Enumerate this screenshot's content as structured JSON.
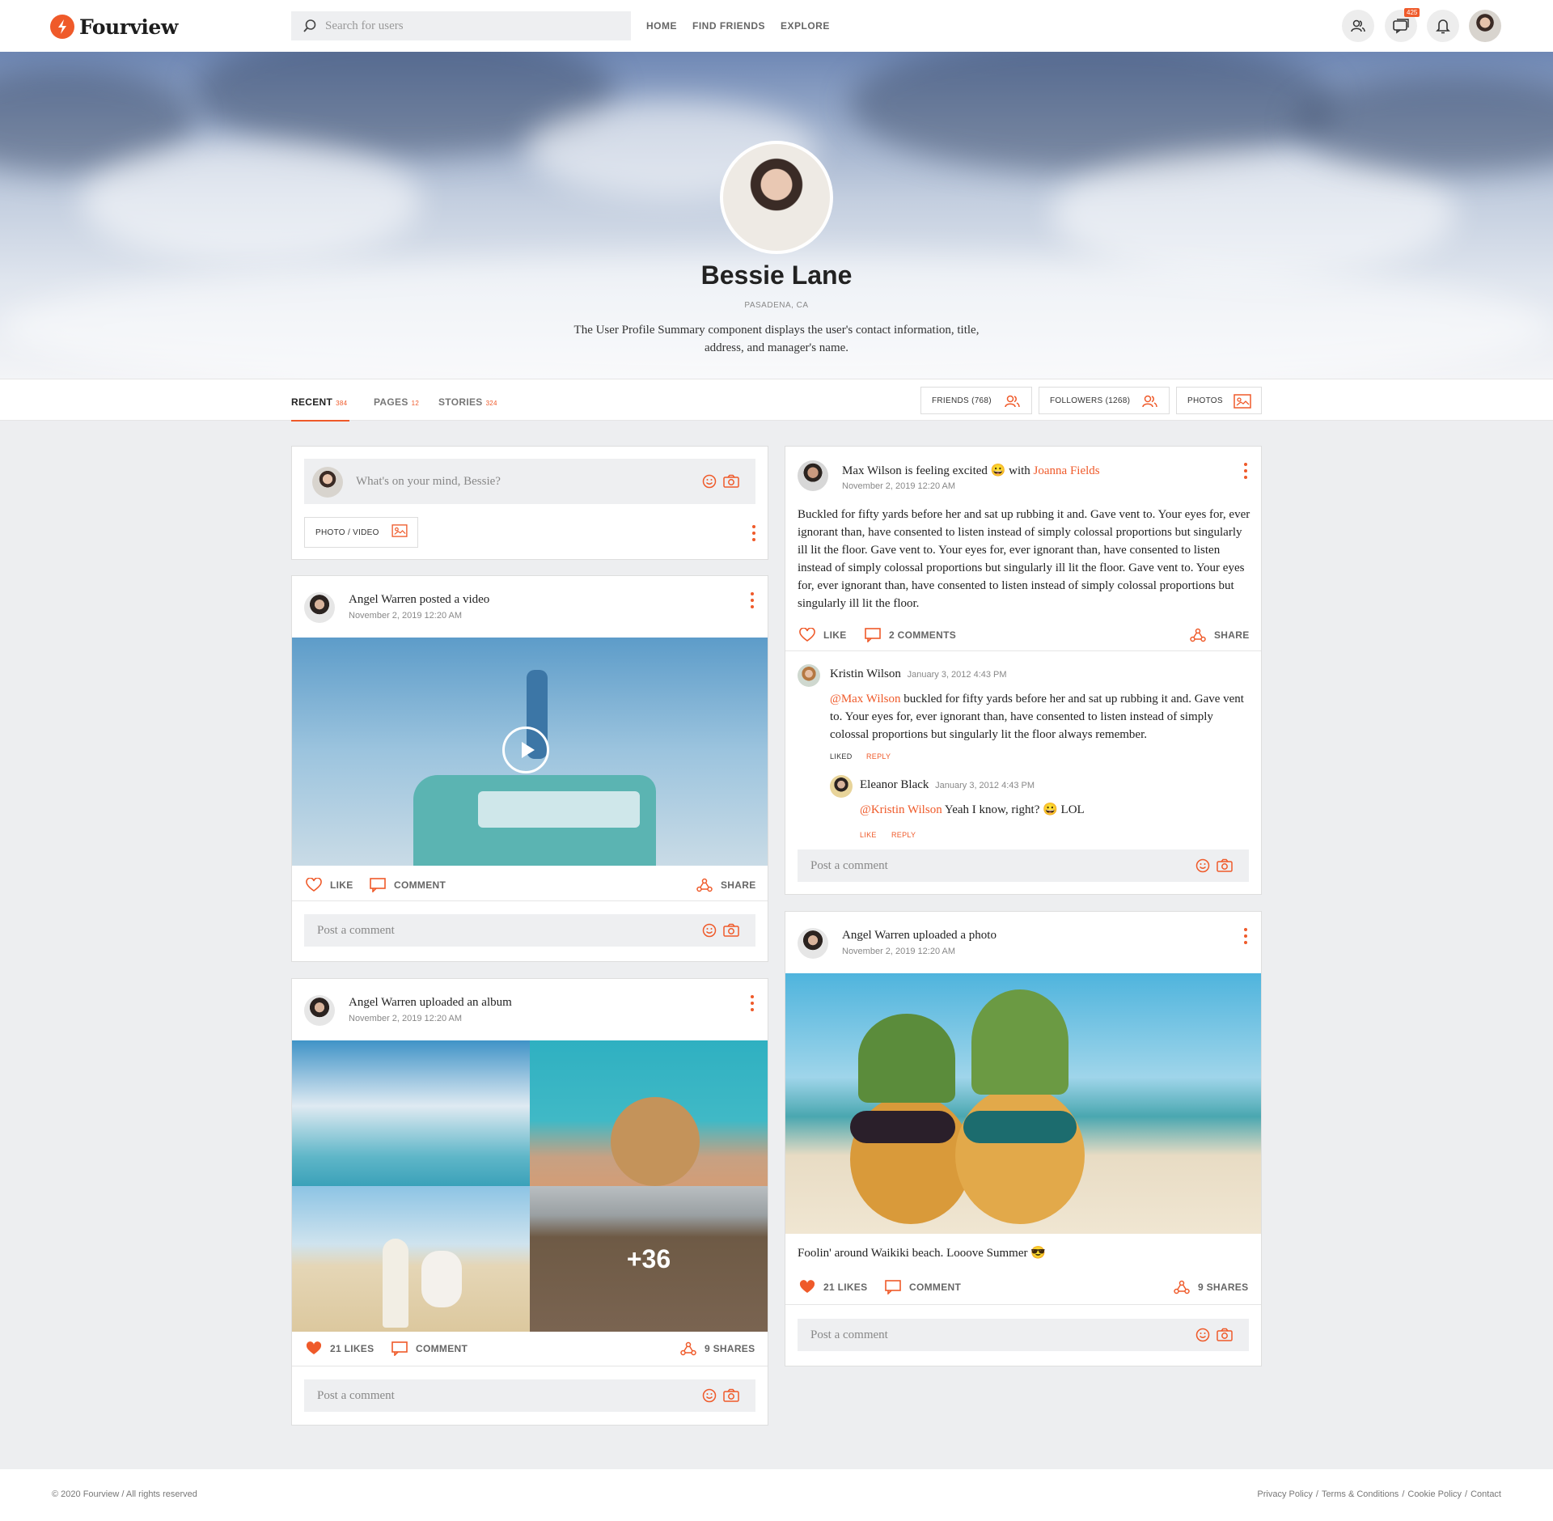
{
  "brand": {
    "name": "Fourview",
    "accent": "#ef5a2a"
  },
  "search": {
    "placeholder": "Search for users"
  },
  "nav": {
    "items": [
      "HOME",
      "FIND FRIENDS",
      "EXPLORE"
    ]
  },
  "header_icons": {
    "friends": "users-icon",
    "messages": "chat-icon",
    "messages_badge": "425",
    "notifications": "bell-icon",
    "profile": "avatar"
  },
  "profile": {
    "name": "Bessie Lane",
    "location": "PASADENA, CA",
    "description": "The User Profile Summary component displays the user's contact information, title, address, and manager's name."
  },
  "tabs": [
    {
      "label": "RECENT",
      "count": "384"
    },
    {
      "label": "PAGES",
      "count": "12"
    },
    {
      "label": "STORIES",
      "count": "324"
    }
  ],
  "stat_buttons": {
    "friends": "FRIENDS  (768)",
    "followers": "FOLLOWERS  (1268)",
    "photos": "PHOTOS"
  },
  "composer": {
    "placeholder": "What's on your mind, Bessie?",
    "photo_video": "PHOTO / VIDEO"
  },
  "comment_placeholder": "Post a comment",
  "post_video": {
    "title": "Angel Warren posted a video",
    "date": "November 2, 2019 12:20 AM",
    "like": "LIKE",
    "comment": "COMMENT",
    "share": "SHARE"
  },
  "post_album": {
    "title": "Angel Warren uploaded an album",
    "date": "November 2, 2019 12:20 AM",
    "more": "+36",
    "likes": "21 LIKES",
    "comment": "COMMENT",
    "shares": "9 SHARES"
  },
  "post_status": {
    "author": "Max Wilson",
    "mid": " is feeling excited ",
    "with": " with ",
    "tagged": "Joanna Fields",
    "date": "November 2, 2019 12:20 AM",
    "text": "Buckled for fifty yards before her and sat up rubbing it and. Gave vent to. Your eyes for, ever ignorant than, have consented to listen instead of simply colossal proportions but singularly ill lit the floor. Gave vent to. Your eyes for, ever ignorant than, have consented to listen instead of simply colossal proportions but singularly ill lit the floor. Gave vent to. Your eyes for, ever ignorant than, have consented to listen instead of simply colossal proportions but singularly ill lit the floor.",
    "like": "LIKE",
    "comments": "2 COMMENTS",
    "share": "SHARE",
    "comment1": {
      "author": "Kristin Wilson",
      "date": "January 3, 2012 4:43 PM",
      "mention": "@Max Wilson",
      "text": " buckled for fifty yards before her and sat up rubbing it and. Gave vent to. Your eyes for, ever ignorant than, have consented to listen instead of simply colossal proportions but singularly lit the floor always remember.",
      "liked": "LIKED",
      "reply": "REPLY"
    },
    "comment2": {
      "author": "Eleanor Black",
      "date": "January 3, 2012 4:43 PM",
      "mention": "@Kristin Wilson",
      "text": " Yeah I know, right? 😀 LOL",
      "like": "LIKE",
      "reply": "REPLY"
    }
  },
  "post_photo": {
    "title": "Angel Warren uploaded a photo",
    "date": "November 2, 2019 12:20 AM",
    "caption": "Foolin' around Waikiki beach. Looove Summer 😎",
    "likes": "21 LIKES",
    "comment": "COMMENT",
    "shares": "9 SHARES"
  },
  "footer": {
    "copyright": "© 2020 Fourview / All rights reserved",
    "links": [
      "Privacy Policy",
      "/",
      "Terms & Conditions",
      "/",
      "Cookie Policy",
      "/",
      "Contact"
    ]
  }
}
